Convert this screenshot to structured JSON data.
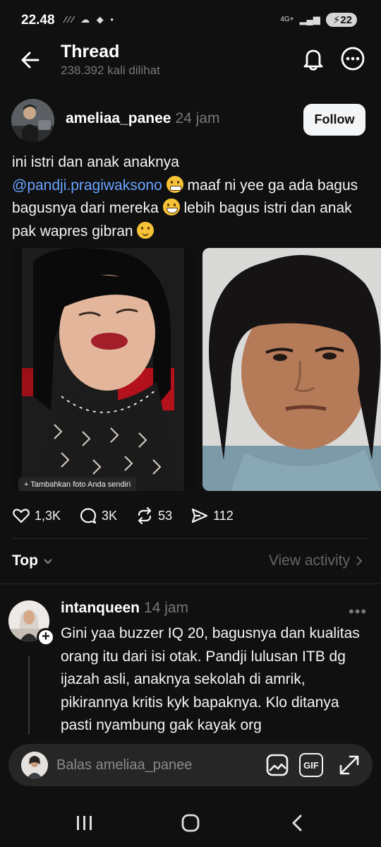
{
  "status_bar": {
    "time": "22.48",
    "icons": "⁄⁄⁄ ☁ ◆ •",
    "network": "4G+",
    "battery": "22"
  },
  "header": {
    "title": "Thread",
    "views": "238.392 kali dilihat"
  },
  "post": {
    "username": "ameliaa_panee",
    "time": "24 jam",
    "follow_label": "Follow",
    "text_1": "ini istri dan anak anaknya",
    "mention": "@pandji.pragiwaksono",
    "text_2": " maaf ni yee ga ada bagus bagusnya dari mereka ",
    "text_3": " lebih bagus istri dan anak pak wapres gibran ",
    "image_caption": "+ Tambahkan foto Anda sendiri",
    "likes": "1,3K",
    "replies": "3K",
    "reposts": "53",
    "shares": "112"
  },
  "sort": {
    "label": "Top",
    "view_activity": "View activity"
  },
  "reply": {
    "username": "intanqueen",
    "time": "14 jam",
    "text": "Gini yaa buzzer IQ 20, bagusnya dan kualitas orang itu dari isi otak. Pandji lulusan ITB dg ijazah asli, anaknya sekolah di amrik, pikirannya kritis kyk bapaknya. Klo ditanya pasti nyambung gak kayak org"
  },
  "reply_bar": {
    "placeholder": "Balas ameliaa_panee",
    "gif_label": "GIF"
  },
  "colors": {
    "background": "#101010",
    "mention": "#6aa4ff",
    "secondary_text": "#777777",
    "follow_button": "#f3f5f7"
  }
}
